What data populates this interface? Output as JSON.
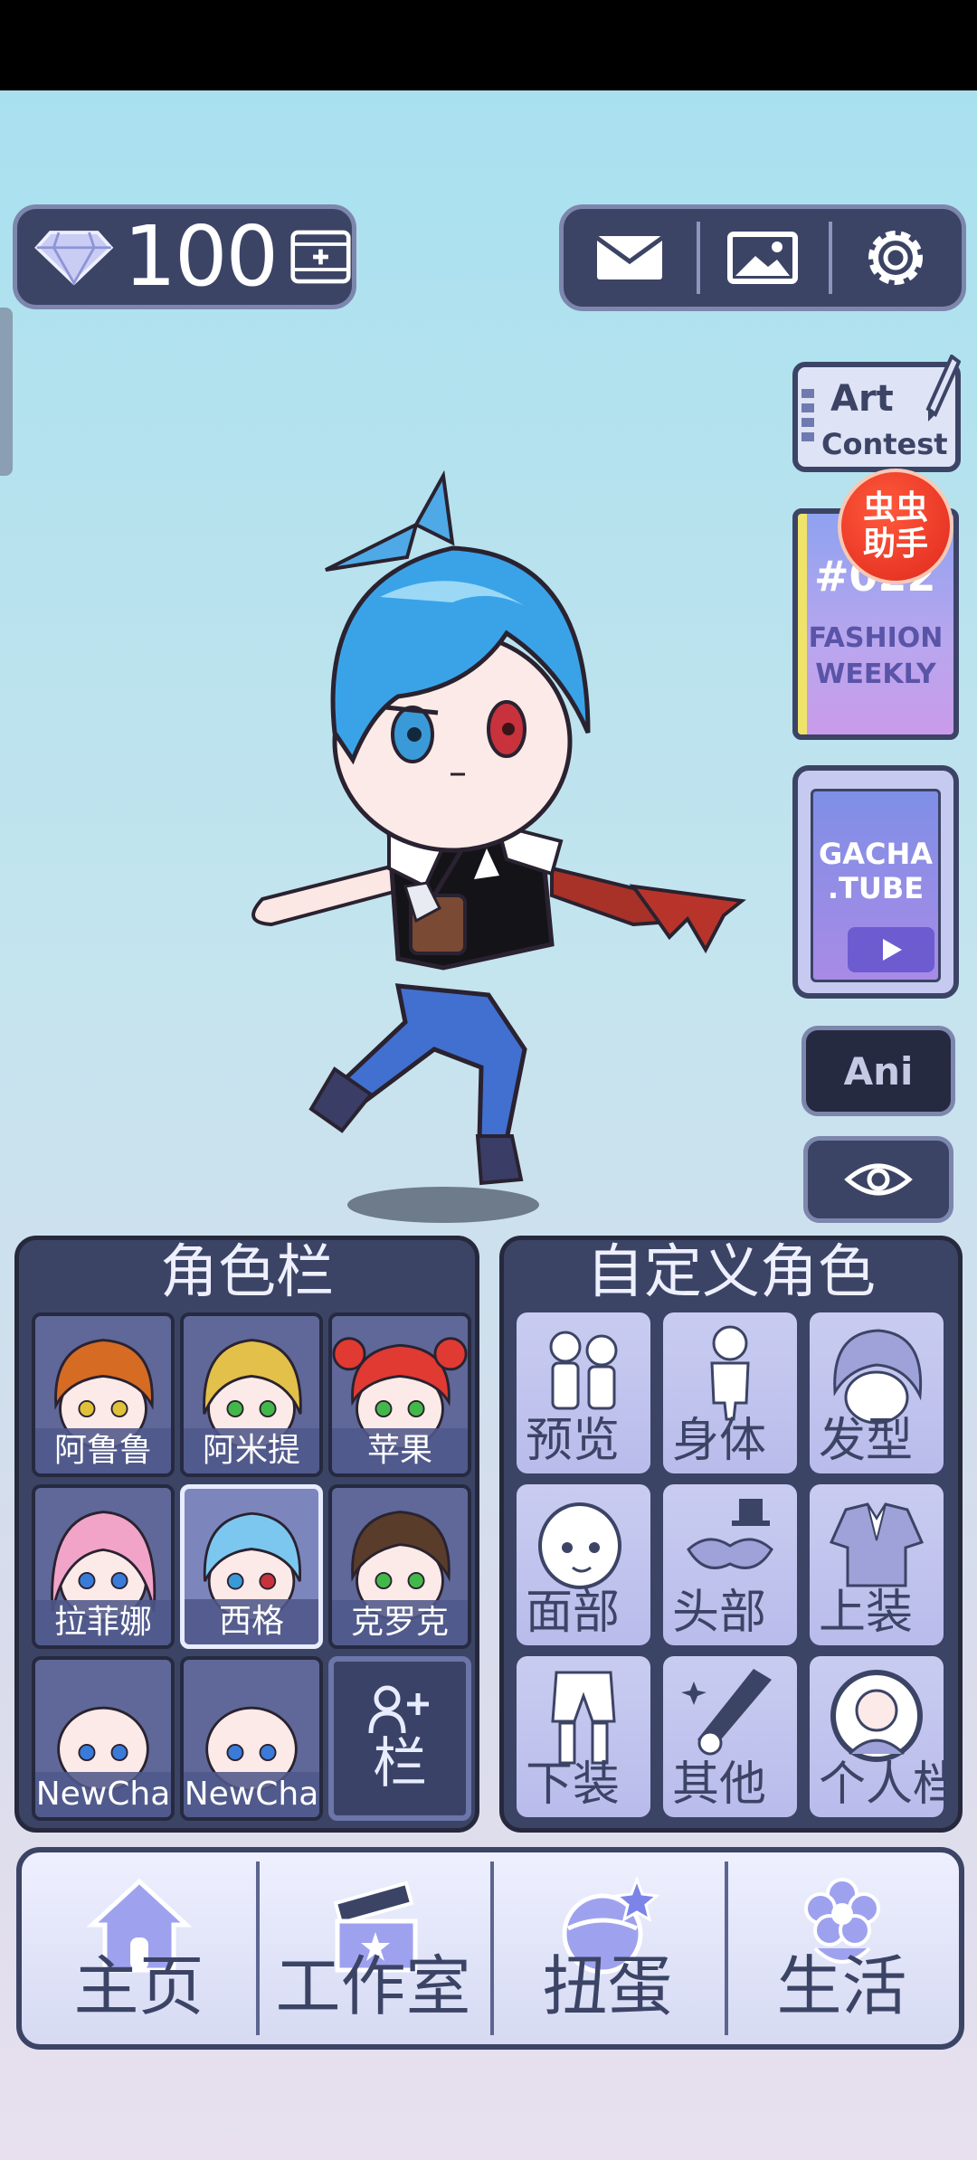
{
  "currency": {
    "gems": "100"
  },
  "roster": {
    "title": "角色栏",
    "slots": [
      {
        "name": "阿鲁鲁",
        "hair": "#d66b24",
        "eye": "#e0c23a"
      },
      {
        "name": "阿米提",
        "hair": "#e2c04a",
        "eye": "#43b84a"
      },
      {
        "name": "苹果",
        "hair": "#e03a33",
        "eye": "#43b84a"
      },
      {
        "name": "拉菲娜",
        "hair": "#f2a3c8",
        "eye": "#3a7ad8"
      },
      {
        "name": "西格",
        "hair": "#7cc7ef",
        "eye": "#3a9ad8",
        "selected": true
      },
      {
        "name": "克罗克",
        "hair": "#5a3c2a",
        "eye": "#43b84a"
      },
      {
        "name": "NewCha",
        "hair": "none",
        "eye": "#3a7ad8"
      },
      {
        "name": "NewCha",
        "hair": "none",
        "eye": "#3a7ad8"
      }
    ],
    "add_label": "栏"
  },
  "custom": {
    "title": "自定义角色",
    "items": [
      {
        "label": "预览",
        "icon": "preview-icon"
      },
      {
        "label": "身体",
        "icon": "body-icon"
      },
      {
        "label": "发型",
        "icon": "hair-icon"
      },
      {
        "label": "面部",
        "icon": "face-icon"
      },
      {
        "label": "头部",
        "icon": "head-accessory-icon"
      },
      {
        "label": "上装",
        "icon": "top-clothing-icon"
      },
      {
        "label": "下装",
        "icon": "bottom-clothing-icon"
      },
      {
        "label": "其他",
        "icon": "other-items-icon"
      },
      {
        "label": "个人档",
        "icon": "profile-icon"
      }
    ]
  },
  "promos": {
    "art_contest": [
      "Art",
      "Contest"
    ],
    "fashion": {
      "tag": "#022",
      "line1": "FASHION",
      "line2": "WEEKLY"
    },
    "badge": [
      "虫虫",
      "助手"
    ],
    "gachatube": [
      "GACHA",
      ".TUBE"
    ]
  },
  "ani_label": "Ani",
  "nav": [
    {
      "label": "主页",
      "icon": "home-icon"
    },
    {
      "label": "工作室",
      "icon": "studio-clapboard-icon"
    },
    {
      "label": "扭蛋",
      "icon": "gacha-egg-icon"
    },
    {
      "label": "生活",
      "icon": "life-flower-icon"
    }
  ],
  "colors": {
    "panel": "#3c4466",
    "border": "#7d86ad",
    "accent_badge": "#e0281d"
  }
}
